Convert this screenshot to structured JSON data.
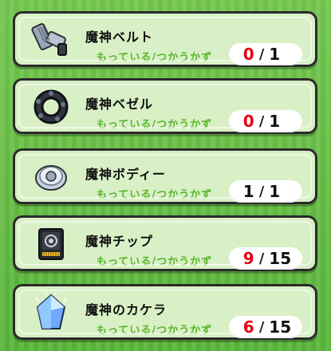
{
  "subtitle_label": "もっている/つかうかず",
  "items": [
    {
      "name": "魔神ベルト",
      "have": "0",
      "slash": "/",
      "need": "1",
      "have_color": "#e60012",
      "icon": "belt-icon"
    },
    {
      "name": "魔神ベゼル",
      "have": "0",
      "slash": "/",
      "need": "1",
      "have_color": "#e60012",
      "icon": "bezel-icon"
    },
    {
      "name": "魔神ボディー",
      "have": "1",
      "slash": "/",
      "need": "1",
      "have_color": "#111111",
      "icon": "body-icon"
    },
    {
      "name": "魔神チップ",
      "have": "9",
      "slash": "/",
      "need": "15",
      "have_color": "#e60012",
      "icon": "chip-icon"
    },
    {
      "name": "魔神のカケラ",
      "have": "6",
      "slash": "/",
      "need": "15",
      "have_color": "#e60012",
      "icon": "crystal-icon"
    }
  ]
}
